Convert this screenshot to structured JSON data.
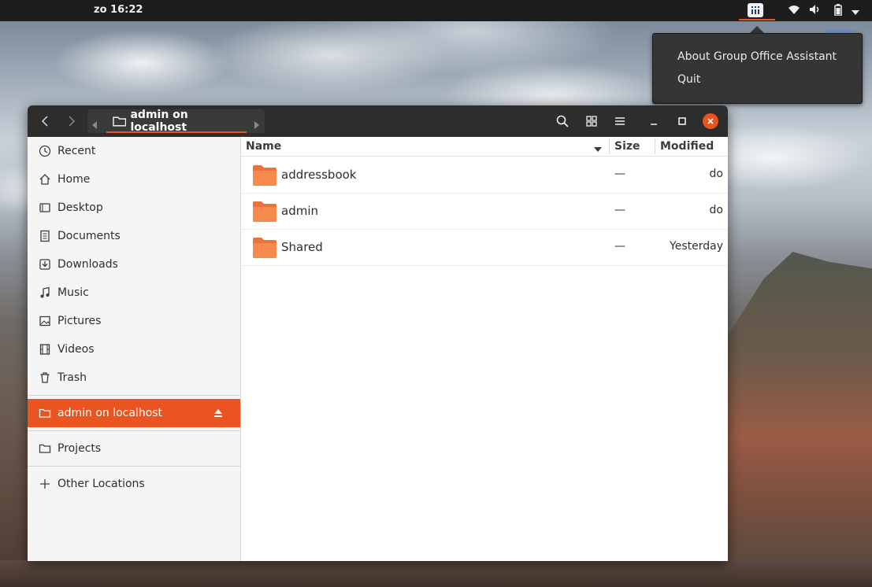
{
  "topbar": {
    "clock": "zo 16:22"
  },
  "popup_menu": {
    "items": [
      {
        "label": "About Group Office Assistant"
      },
      {
        "label": "Quit"
      }
    ]
  },
  "window": {
    "path_label": "admin on localhost"
  },
  "sidebar": {
    "items": [
      {
        "label": "Recent",
        "icon": "clock-icon"
      },
      {
        "label": "Home",
        "icon": "home-icon"
      },
      {
        "label": "Desktop",
        "icon": "desktop-icon"
      },
      {
        "label": "Documents",
        "icon": "document-icon"
      },
      {
        "label": "Downloads",
        "icon": "download-icon"
      },
      {
        "label": "Music",
        "icon": "music-note-icon"
      },
      {
        "label": "Pictures",
        "icon": "image-icon"
      },
      {
        "label": "Videos",
        "icon": "film-icon"
      },
      {
        "label": "Trash",
        "icon": "trash-icon"
      }
    ],
    "mounted": {
      "label": "admin on localhost",
      "icon": "folder-network-icon"
    },
    "bookmarks": [
      {
        "label": "Projects",
        "icon": "folder-icon"
      }
    ],
    "other": {
      "label": "Other Locations",
      "icon": "plus-icon"
    }
  },
  "file_list": {
    "columns": {
      "name": "Name",
      "size": "Size",
      "modified": "Modified"
    },
    "rows": [
      {
        "name": "addressbook",
        "size": "—",
        "modified": "do"
      },
      {
        "name": "admin",
        "size": "—",
        "modified": "do"
      },
      {
        "name": "Shared",
        "size": "—",
        "modified": "Yesterday"
      }
    ]
  },
  "colors": {
    "accent": "#e95420",
    "headerbar": "#2d2d2d",
    "folder": "#f68a4c"
  }
}
